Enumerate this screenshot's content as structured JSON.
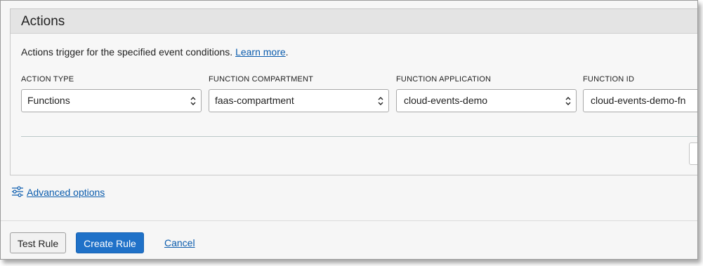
{
  "panel": {
    "title": "Actions",
    "description": "Actions trigger for the specified event conditions.",
    "learn_more": "Learn more",
    "period": "."
  },
  "fields": [
    {
      "label": "ACTION TYPE",
      "value": "Functions"
    },
    {
      "label": "FUNCTION COMPARTMENT",
      "value": "faas-compartment"
    },
    {
      "label": "FUNCTION APPLICATION",
      "value": "cloud-events-demo"
    },
    {
      "label": "FUNCTION ID",
      "value": "cloud-events-demo-fn"
    }
  ],
  "advanced": {
    "label": "Advanced options",
    "icon": "sliders-icon"
  },
  "footer": {
    "test_rule": "Test Rule",
    "create_rule": "Create Rule",
    "cancel": "Cancel"
  },
  "colors": {
    "primary_button": "#1f71c8",
    "link": "#0b5cad",
    "panel_header": "#e4e4e4"
  }
}
